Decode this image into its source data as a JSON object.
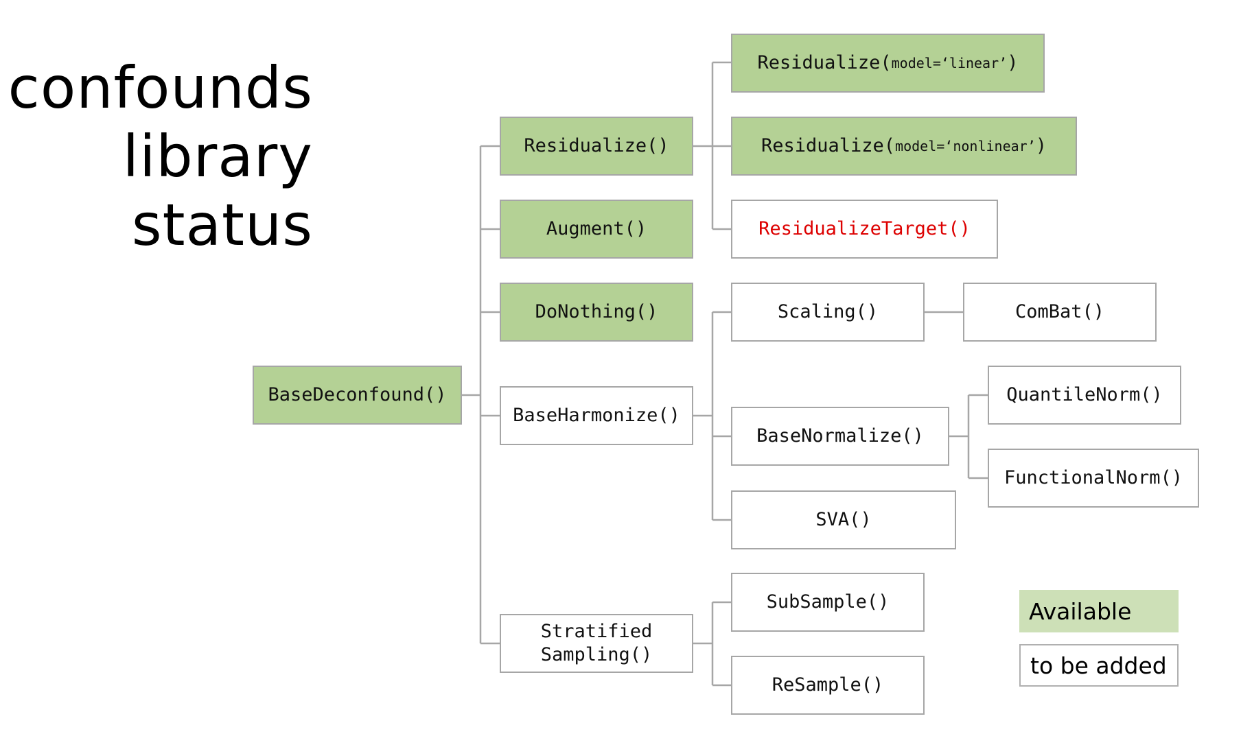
{
  "title": {
    "lines": [
      "confounds",
      "library",
      "status"
    ]
  },
  "colors": {
    "available": "#b4d195",
    "todo": "#ffffff",
    "connector": "#a6a6a6",
    "pending_text": "#dd0000"
  },
  "nodes": {
    "base_deconfound": {
      "label": "BaseDeconfound()",
      "status": "available"
    },
    "residualize": {
      "label": "Residualize()",
      "status": "available"
    },
    "augment": {
      "label": "Augment()",
      "status": "available"
    },
    "do_nothing": {
      "label": "DoNothing()",
      "status": "available"
    },
    "base_harmonize": {
      "label": "BaseHarmonize()",
      "status": "to be added"
    },
    "stratified_sampling": {
      "label_line1": "Stratified",
      "label_line2": "Sampling()",
      "status": "to be added"
    },
    "residualize_linear": {
      "name": "Residualize(",
      "arg": "model=‘linear’",
      "close": ")",
      "status": "available"
    },
    "residualize_nonlinear": {
      "name": "Residualize(",
      "arg": "model=‘nonlinear’",
      "close": ")",
      "status": "available"
    },
    "residualize_target": {
      "label": "ResidualizeTarget()",
      "status": "to be added"
    },
    "scaling": {
      "label": "Scaling()",
      "status": "to be added"
    },
    "combat": {
      "label": "ComBat()",
      "status": "to be added"
    },
    "base_normalize": {
      "label": "BaseNormalize()",
      "status": "to be added"
    },
    "quantile_norm": {
      "label": "QuantileNorm()",
      "status": "to be added"
    },
    "functional_norm": {
      "label": "FunctionalNorm()",
      "status": "to be added"
    },
    "sva": {
      "label": "SVA()",
      "status": "to be added"
    },
    "subsample": {
      "label": "SubSample()",
      "status": "to be added"
    },
    "resample": {
      "label": "ReSample()",
      "status": "to be added"
    }
  },
  "legend": {
    "available": "Available",
    "todo": "to be added"
  }
}
